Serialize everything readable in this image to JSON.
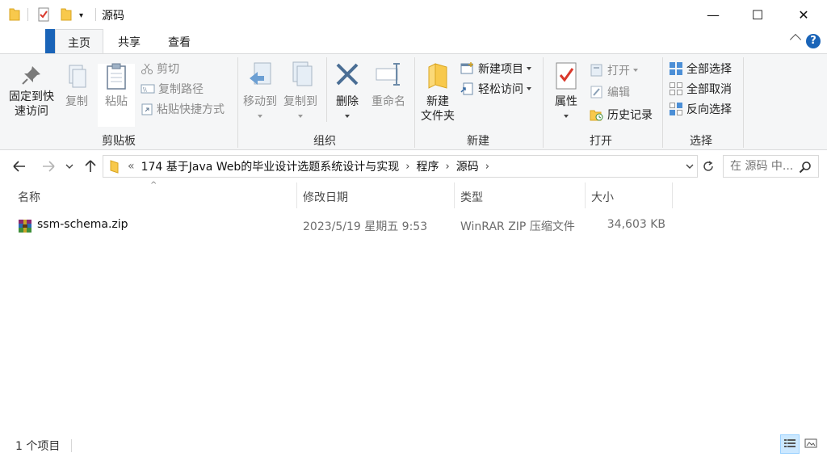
{
  "window": {
    "title": "源码",
    "minimize_glyph": "—",
    "maximize_glyph": "☐",
    "close_glyph": "✕"
  },
  "tabs": {
    "items": [
      {
        "label": "主页",
        "active": true
      },
      {
        "label": "共享",
        "active": false
      },
      {
        "label": "查看",
        "active": false
      }
    ],
    "help_glyph": "?"
  },
  "ribbon": {
    "clipboard": {
      "group_label": "剪贴板",
      "pin_label_line1": "固定到快",
      "pin_label_line2": "速访问",
      "copy_label": "复制",
      "paste_label": "粘贴",
      "cut_label": "剪切",
      "copy_path_label": "复制路径",
      "paste_shortcut_label": "粘贴快捷方式"
    },
    "organize": {
      "group_label": "组织",
      "move_to_label": "移动到",
      "copy_to_label": "复制到",
      "delete_label": "删除",
      "rename_label": "重命名"
    },
    "new": {
      "group_label": "新建",
      "new_folder_line1": "新建",
      "new_folder_line2": "文件夹",
      "new_item_label": "新建项目",
      "easy_access_label": "轻松访问"
    },
    "open": {
      "group_label": "打开",
      "properties_label": "属性",
      "open_label": "打开",
      "edit_label": "编辑",
      "history_label": "历史记录"
    },
    "select": {
      "group_label": "选择",
      "select_all_label": "全部选择",
      "select_none_label": "全部取消",
      "invert_label": "反向选择"
    }
  },
  "address": {
    "prefix": "«",
    "crumbs": [
      "174  基于Java Web的毕业设计选题系统设计与实现",
      "程序",
      "源码"
    ],
    "crumb_arrow": "›",
    "search_placeholder": "在 源码 中..."
  },
  "columns": {
    "name": "名称",
    "modified": "修改日期",
    "type": "类型",
    "size": "大小"
  },
  "files": [
    {
      "name": "ssm-schema.zip",
      "modified": "2023/5/19 星期五 9:53",
      "type": "WinRAR ZIP 压缩文件",
      "size": "34,603 KB",
      "icon": "winrar-archive-icon"
    }
  ],
  "status": {
    "item_count": "1 个项目"
  },
  "colors": {
    "accent": "#1a64b8",
    "ribbon_bg": "#f5f6f7",
    "folder_yellow": "#f8c94c"
  }
}
